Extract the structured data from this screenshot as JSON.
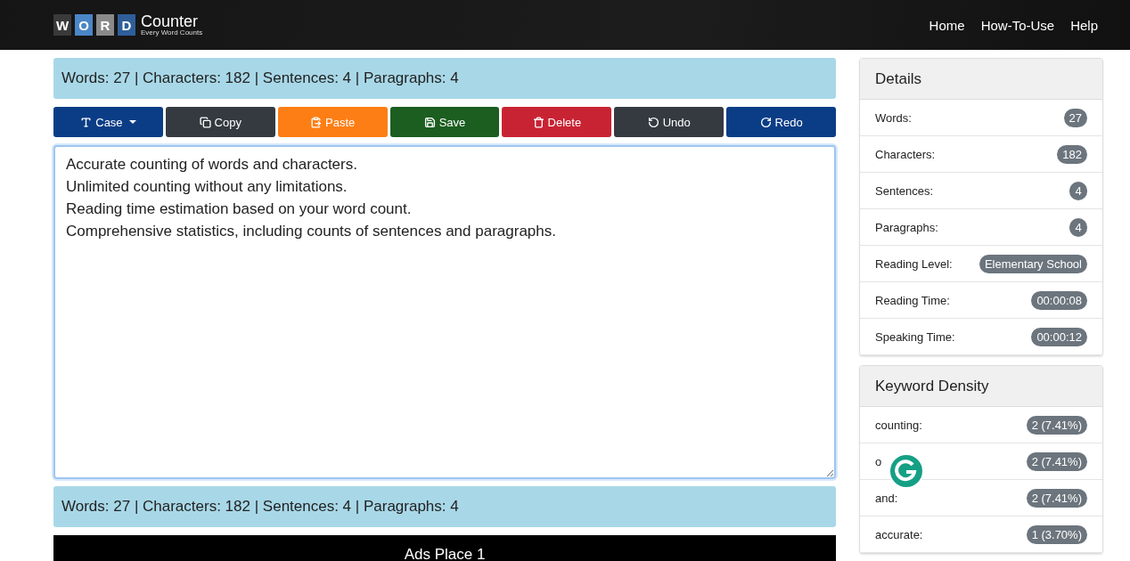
{
  "header": {
    "logo": {
      "letters": [
        "W",
        "O",
        "R",
        "D"
      ],
      "name": "Counter",
      "tagline": "Every Word Counts"
    },
    "nav": [
      {
        "label": "Home"
      },
      {
        "label": "How-To-Use"
      },
      {
        "label": "Help"
      }
    ]
  },
  "stats_top": "Words: 27 | Characters: 182 | Sentences: 4 | Paragraphs: 4",
  "toolbar": [
    {
      "kind": "case",
      "label": "Case",
      "color": "#0b3d86"
    },
    {
      "kind": "copy",
      "label": "Copy",
      "color": "#343a40"
    },
    {
      "kind": "paste",
      "label": "Paste",
      "color": "#fd7e14"
    },
    {
      "kind": "save",
      "label": "Save",
      "color": "#1b5e20"
    },
    {
      "kind": "delete",
      "label": "Delete",
      "color": "#c82333"
    },
    {
      "kind": "undo",
      "label": "Undo",
      "color": "#343a40"
    },
    {
      "kind": "redo",
      "label": "Redo",
      "color": "#0b3d86"
    }
  ],
  "editor": {
    "lines": [
      "Accurate counting of words and characters.",
      "Unlimited counting without any limitations.",
      "Reading time estimation based on your word count.",
      "Comprehensive statistics, including counts of sentences and paragraphs."
    ]
  },
  "stats_bottom": "Words: 27 | Characters: 182 | Sentences: 4 | Paragraphs: 4",
  "ad": "Ads Place 1",
  "details": {
    "title": "Details",
    "items": [
      {
        "label": "Words:",
        "value": "27"
      },
      {
        "label": "Characters:",
        "value": "182"
      },
      {
        "label": "Sentences:",
        "value": "4"
      },
      {
        "label": "Paragraphs:",
        "value": "4"
      },
      {
        "label": "Reading Level:",
        "value": "Elementary School"
      },
      {
        "label": "Reading Time:",
        "value": "00:00:08"
      },
      {
        "label": "Speaking Time:",
        "value": "00:00:12"
      }
    ]
  },
  "keyword_density": {
    "title": "Keyword Density",
    "items": [
      {
        "word": "counting:",
        "value": "2 (7.41%)"
      },
      {
        "word": "o",
        "value": "2 (7.41%)"
      },
      {
        "word": "and:",
        "value": "2 (7.41%)"
      },
      {
        "word": "accurate:",
        "value": "1 (3.70%)"
      }
    ]
  }
}
